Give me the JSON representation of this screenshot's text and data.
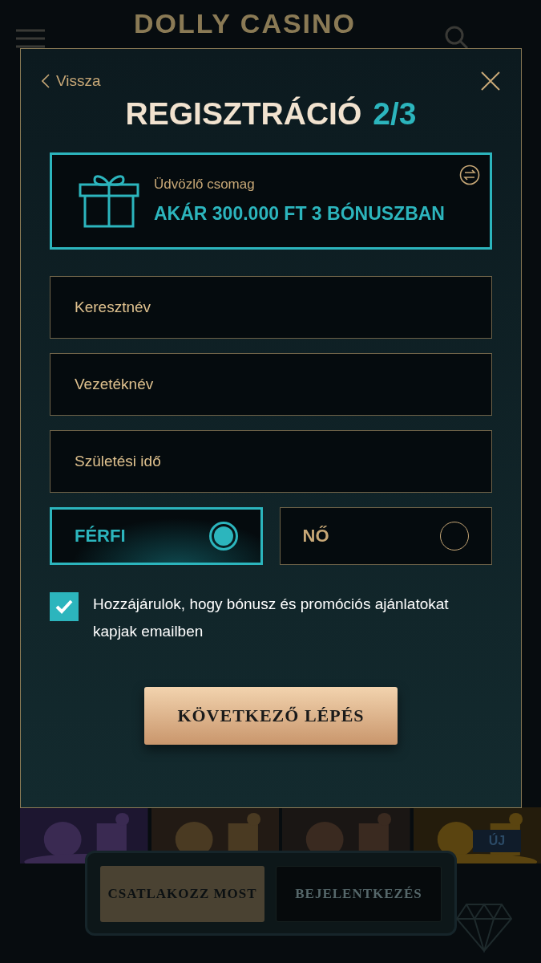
{
  "background": {
    "logo": "DOLLY CASINO",
    "new_badge": "ÚJ",
    "buttons": [
      {
        "label": "CSATLAKOZZ MOST",
        "kind": "primary"
      },
      {
        "label": "BEJELENTKEZÉS",
        "kind": "secondary"
      }
    ]
  },
  "modal": {
    "back": "Vissza",
    "title": "REGISZTRÁCIÓ",
    "step": "2/3",
    "promo": {
      "label": "Üdvözlő csomag",
      "offer": "AKÁR 300.000 FT 3 BÓNUSZBAN"
    },
    "fields": [
      {
        "placeholder": "Keresztnév"
      },
      {
        "placeholder": "Vezetéknév"
      },
      {
        "placeholder": "Születési idő"
      }
    ],
    "gender_options": [
      {
        "label": "FÉRFI",
        "selected": true
      },
      {
        "label": "NŐ",
        "selected": false
      }
    ],
    "consent": {
      "text": "Hozzájárulok, hogy bónusz és promóciós ajánlatokat kapjak emailben",
      "checked": true
    },
    "next_button": "KÖVETKEZŐ LÉPÉS"
  }
}
